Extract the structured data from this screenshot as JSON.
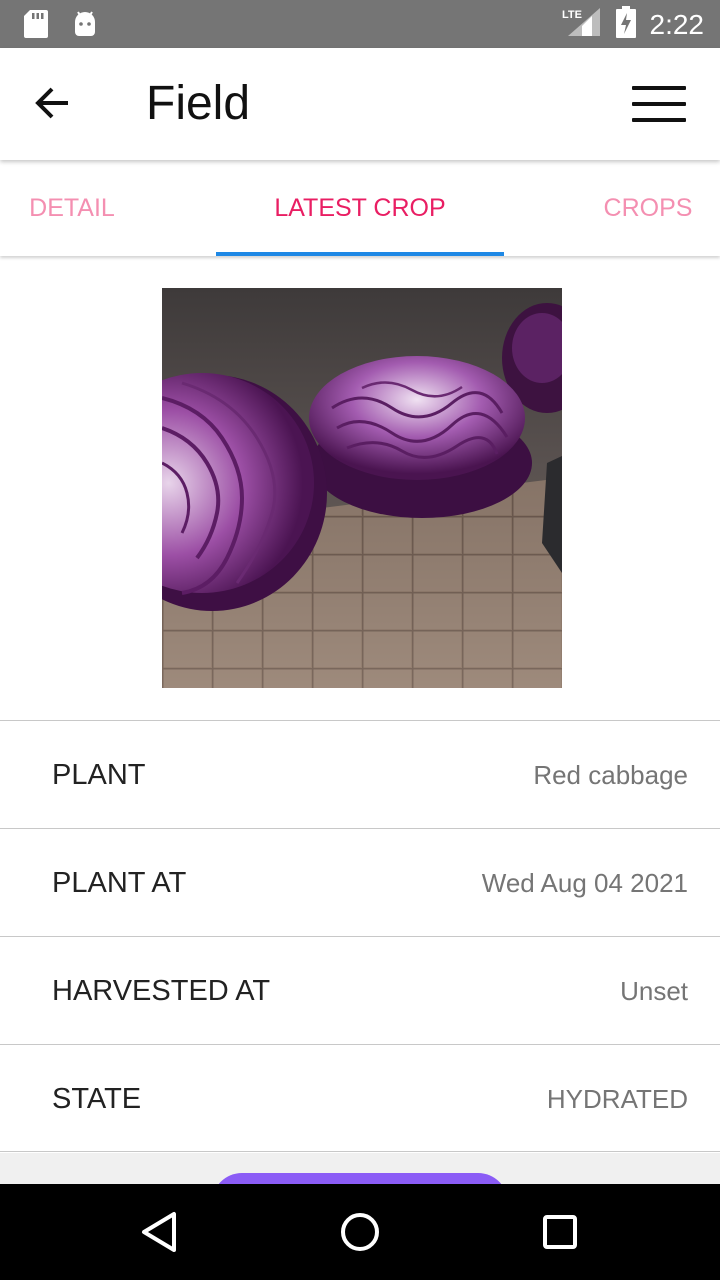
{
  "status_bar": {
    "time": "2:22",
    "network": "LTE",
    "icons": [
      "sd-card-icon",
      "android-icon",
      "lte-signal-icon",
      "battery-charging-icon"
    ]
  },
  "app_bar": {
    "title": "Field",
    "back_icon": "arrow-left-icon",
    "menu_icon": "hamburger-menu-icon"
  },
  "tabs": [
    {
      "label": "DETAIL",
      "active": false
    },
    {
      "label": "LATEST CROP",
      "active": true
    },
    {
      "label": "CROPS",
      "active": false
    }
  ],
  "crop": {
    "image": "red-cabbage-photo",
    "rows": [
      {
        "label": "PLANT",
        "value": "Red cabbage"
      },
      {
        "label": "PLANT AT",
        "value": "Wed Aug 04 2021"
      },
      {
        "label": "HARVESTED AT",
        "value": "Unset"
      },
      {
        "label": "STATE",
        "value": "HYDRATED"
      }
    ]
  },
  "colors": {
    "status_bar": "#757575",
    "tab_active": "#e91e63",
    "tab_inactive": "#f48fb1",
    "tab_indicator": "#1e88e5",
    "fab": "#8b5cf6"
  },
  "nav_bar": {
    "icons": [
      "back-triangle-icon",
      "home-circle-icon",
      "recents-square-icon"
    ]
  }
}
